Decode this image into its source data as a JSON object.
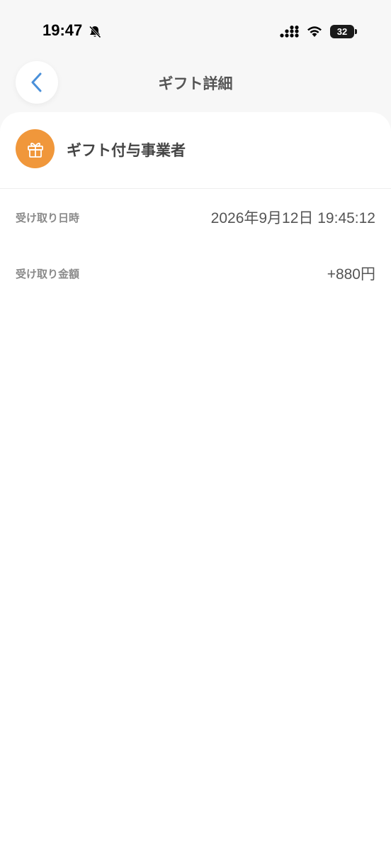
{
  "status_bar": {
    "time": "19:47",
    "battery_level": "32"
  },
  "header": {
    "title": "ギフト詳細"
  },
  "issuer": {
    "name": "ギフト付与事業者",
    "badge_color": "#f0973b"
  },
  "details": [
    {
      "label": "受け取り日時",
      "value": "2026年9月12日 19:45:12"
    },
    {
      "label": "受け取り金額",
      "value": "+880円"
    }
  ],
  "colors": {
    "accent": "#4a90d9",
    "gift_orange": "#f0973b"
  }
}
